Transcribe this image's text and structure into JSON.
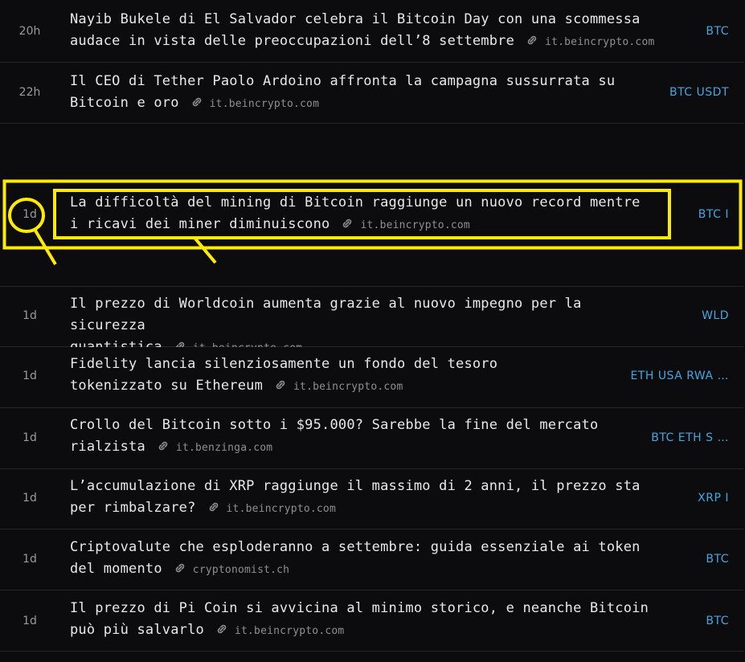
{
  "news_items": [
    {
      "time": "20h",
      "line1": "Nayib Bukele di El Salvador celebra il Bitcoin Day con una scommessa",
      "line2": "audace in vista delle preoccupazioni dell’8 settembre",
      "source": "it.beincrypto.com",
      "tags": "BTC"
    },
    {
      "time": "22h",
      "line1": "Il CEO di Tether Paolo Ardoino affronta la campagna sussurrata su",
      "line2": "Bitcoin e oro",
      "source": "it.beincrypto.com",
      "tags": "BTC USDT"
    },
    {
      "time": "1d",
      "line1": "La difficoltà del mining di Bitcoin raggiunge un nuovo record mentre",
      "line2": "i ricavi dei miner diminuiscono",
      "source": "it.beincrypto.com",
      "tags": "BTC I"
    },
    {
      "time": "1d",
      "line1": "Il prezzo di Worldcoin aumenta grazie al nuovo impegno per la sicurezza",
      "line2": "quantistica",
      "source": "it.beincrypto.com",
      "tags": "WLD"
    },
    {
      "time": "1d",
      "line1": "Fidelity lancia silenziosamente un fondo del tesoro",
      "line2": "tokenizzato su Ethereum",
      "source": "it.beincrypto.com",
      "tags": "ETH USA RWA …"
    },
    {
      "time": "1d",
      "line1": "Crollo del Bitcoin sotto i $95.000? Sarebbe la fine del mercato",
      "line2": "rialzista",
      "source": "it.benzinga.com",
      "tags": "BTC ETH S …"
    },
    {
      "time": "1d",
      "line1": "L’accumulazione di XRP raggiunge il massimo di 2 anni, il prezzo sta",
      "line2": "per rimbalzare?",
      "source": "it.beincrypto.com",
      "tags": "XRP I"
    },
    {
      "time": "1d",
      "line1": "Criptovalute che esploderanno a settembre: guida essenziale ai token",
      "line2": "del momento",
      "source": "cryptonomist.ch",
      "tags": "BTC"
    },
    {
      "time": "1d",
      "line1": "Il prezzo di Pi Coin si avvicina al minimo storico, e neanche Bitcoin",
      "line2": "può più salvarlo",
      "source": "it.beincrypto.com",
      "tags": "BTC"
    }
  ],
  "colors": {
    "background": "#0c0c0e",
    "divider": "#26262a",
    "title_text": "#e8e8e8",
    "time_text": "#9a9a9a",
    "source_text": "#8f8f8f",
    "tag_text": "#44a6e0",
    "highlight": "#ffeb00"
  },
  "icons": {
    "source_link": "link-icon"
  }
}
